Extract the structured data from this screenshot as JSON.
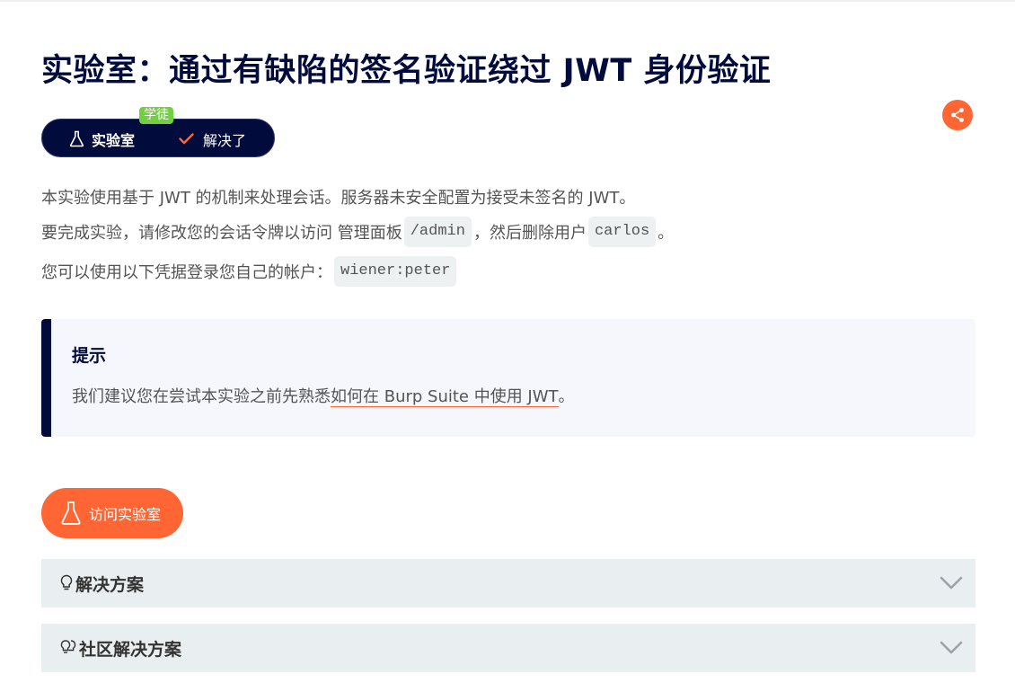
{
  "title": "实验室：通过有缺陷的签名验证绕过 JWT 身份验证",
  "share": {
    "icon": "share-icon"
  },
  "badge": {
    "lab_label": "实验室",
    "level": "学徒",
    "status": "解决了"
  },
  "description": {
    "line1": "本实验使用基于 JWT 的机制来处理会话。服务器未安全配置为接受未签名的 JWT。",
    "line2_prefix": "要完成实验，请修改您的会话令牌以访问 管理面板",
    "line2_code1": "/admin",
    "line2_mid": "，然后删除用户",
    "line2_code2": "carlos",
    "line2_suffix": "。",
    "line3_prefix": "您可以使用以下凭据登录您自己的帐户：",
    "line3_code": "wiener:peter"
  },
  "hint": {
    "title": "提示",
    "text_prefix": "我们建议您在尝试本实验之前先熟悉",
    "link_text": "如何在 Burp Suite 中使用 JWT",
    "text_suffix": "。"
  },
  "access_button": {
    "label": "访问实验室"
  },
  "accordions": [
    {
      "label": "解决方案",
      "icon": "lightbulb-icon"
    },
    {
      "label": "社区解决方案",
      "icon": "lightbulbs-icon"
    }
  ],
  "colors": {
    "navy": "#010c3d",
    "orange": "#ff6633",
    "green": "#70d13e",
    "panel": "#e9eef1"
  }
}
